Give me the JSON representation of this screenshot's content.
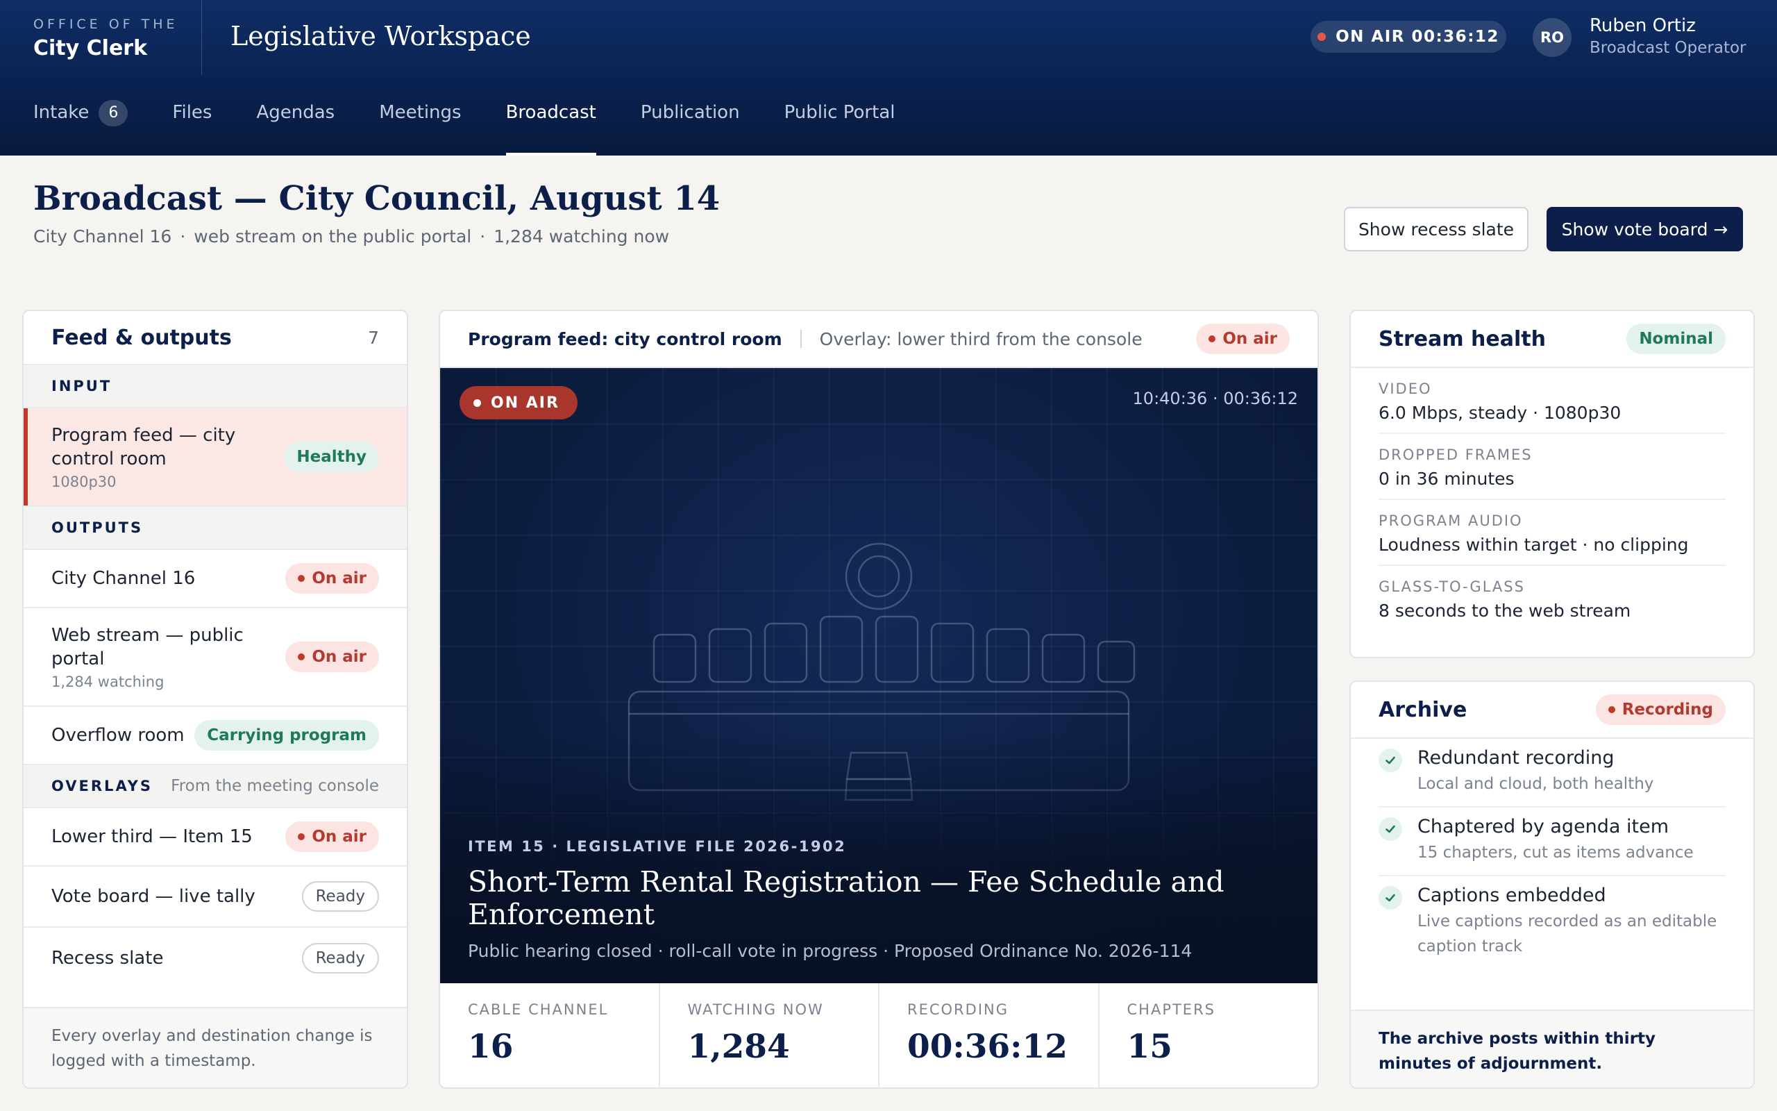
{
  "header": {
    "brand_small": "OFFICE OF THE",
    "brand_name": "City Clerk",
    "app_title": "Legislative Workspace",
    "on_air_label": "ON AIR 00:36:12",
    "user_initials": "RO",
    "user_name": "Ruben Ortiz",
    "user_role": "Broadcast Operator"
  },
  "nav": {
    "items": [
      {
        "label": "Intake",
        "badge": "6"
      },
      {
        "label": "Files"
      },
      {
        "label": "Agendas"
      },
      {
        "label": "Meetings"
      },
      {
        "label": "Broadcast",
        "active": true
      },
      {
        "label": "Publication"
      },
      {
        "label": "Public Portal"
      }
    ]
  },
  "page": {
    "title": "Broadcast — City Council, August 14",
    "subtitle_parts": [
      "City Channel 16",
      "·",
      "web stream on the public portal",
      "·",
      "1,284 watching now"
    ],
    "recess_button": "Show recess slate",
    "vote_button": "Show vote board →"
  },
  "feed": {
    "title": "Feed & outputs",
    "count": "7",
    "input_label": "INPUT",
    "input": {
      "name": "Program feed — city control room",
      "detail": "1080p30",
      "status": "Healthy"
    },
    "outputs_label": "OUTPUTS",
    "outputs": [
      {
        "name": "City Channel 16",
        "status": "On air"
      },
      {
        "name": "Web stream — public portal",
        "detail": "1,284 watching",
        "status": "On air"
      },
      {
        "name": "Overflow room",
        "status": "Carrying program"
      }
    ],
    "overlays_label": "OVERLAYS",
    "overlays_note": "From the meeting console",
    "overlays": [
      {
        "name": "Lower third — Item 15",
        "status": "On air"
      },
      {
        "name": "Vote board — live tally",
        "status": "Ready"
      },
      {
        "name": "Recess slate",
        "status": "Ready"
      }
    ],
    "footer": "Every overlay and destination change is logged with a timestamp."
  },
  "program": {
    "title": "Program feed: city control room",
    "overlay": "Overlay: lower third from the console",
    "status": "On air",
    "video_tag": "ON AIR",
    "video_time": "10:40:36 · 00:36:12",
    "lower_third": {
      "kicker": "ITEM 15 · LEGISLATIVE FILE 2026-1902",
      "title": "Short-Term Rental Registration — Fee Schedule and Enforcement",
      "subtitle": "Public hearing closed · roll-call vote in progress · Proposed Ordinance No. 2026-114"
    },
    "stats": [
      {
        "label": "CABLE CHANNEL",
        "value": "16"
      },
      {
        "label": "WATCHING NOW",
        "value": "1,284"
      },
      {
        "label": "RECORDING",
        "value": "00:36:12"
      },
      {
        "label": "CHAPTERS",
        "value": "15"
      }
    ]
  },
  "health": {
    "title": "Stream health",
    "status": "Nominal",
    "metrics": [
      {
        "label": "VIDEO",
        "value": "6.0 Mbps, steady · 1080p30"
      },
      {
        "label": "DROPPED FRAMES",
        "value": "0 in 36 minutes"
      },
      {
        "label": "PROGRAM AUDIO",
        "value": "Loudness within target · no clipping"
      },
      {
        "label": "GLASS-TO-GLASS",
        "value": "8 seconds to the web stream"
      }
    ]
  },
  "archive": {
    "title": "Archive",
    "status": "Recording",
    "items": [
      {
        "title": "Redundant recording",
        "detail": "Local and cloud, both healthy"
      },
      {
        "title": "Chaptered by agenda item",
        "detail": "15 chapters, cut as items advance"
      },
      {
        "title": "Captions embedded",
        "detail": "Live captions recorded as an editable caption track"
      }
    ],
    "footer": "The archive posts within thirty minutes of adjournment."
  },
  "colors": {
    "navy": "#0b1f4a",
    "header_top": "#0f2e66",
    "on_air_red": "#c0392b",
    "healthy_green": "#1f7a58"
  }
}
